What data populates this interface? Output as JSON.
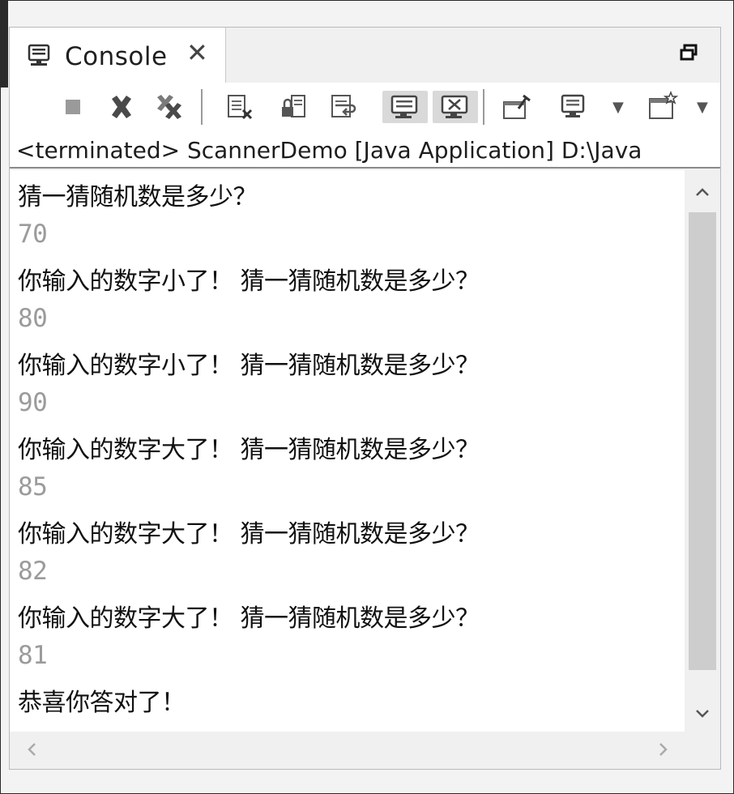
{
  "tab": {
    "title": "Console",
    "icon": "console-monitor-icon"
  },
  "toolbar": {
    "icons": [
      "terminate-icon",
      "remove-launch-icon",
      "remove-all-terminated-icon",
      "clear-console-icon",
      "scroll-lock-icon",
      "word-wrap-icon",
      "show-console-on-stdout-icon",
      "show-console-on-stderr-icon",
      "pin-console-icon",
      "display-selected-console-icon",
      "open-console-icon"
    ]
  },
  "status": "<terminated> ScannerDemo [Java Application] D:\\Java",
  "console_lines": [
    {
      "text": "猜一猜随机数是多少？",
      "kind": "out"
    },
    {
      "text": "70",
      "kind": "in"
    },
    {
      "text": "你输入的数字小了！ 猜一猜随机数是多少？",
      "kind": "out"
    },
    {
      "text": "80",
      "kind": "in"
    },
    {
      "text": "你输入的数字小了！ 猜一猜随机数是多少？",
      "kind": "out"
    },
    {
      "text": "90",
      "kind": "in"
    },
    {
      "text": "你输入的数字大了！ 猜一猜随机数是多少？",
      "kind": "out"
    },
    {
      "text": "85",
      "kind": "in"
    },
    {
      "text": "你输入的数字大了！ 猜一猜随机数是多少？",
      "kind": "out"
    },
    {
      "text": "82",
      "kind": "in"
    },
    {
      "text": "你输入的数字大了！ 猜一猜随机数是多少？",
      "kind": "out"
    },
    {
      "text": "81",
      "kind": "in"
    },
    {
      "text": "恭喜你答对了！",
      "kind": "out"
    }
  ],
  "colors": {
    "stdout": "#111111",
    "stdin": "#9b9b9b"
  }
}
